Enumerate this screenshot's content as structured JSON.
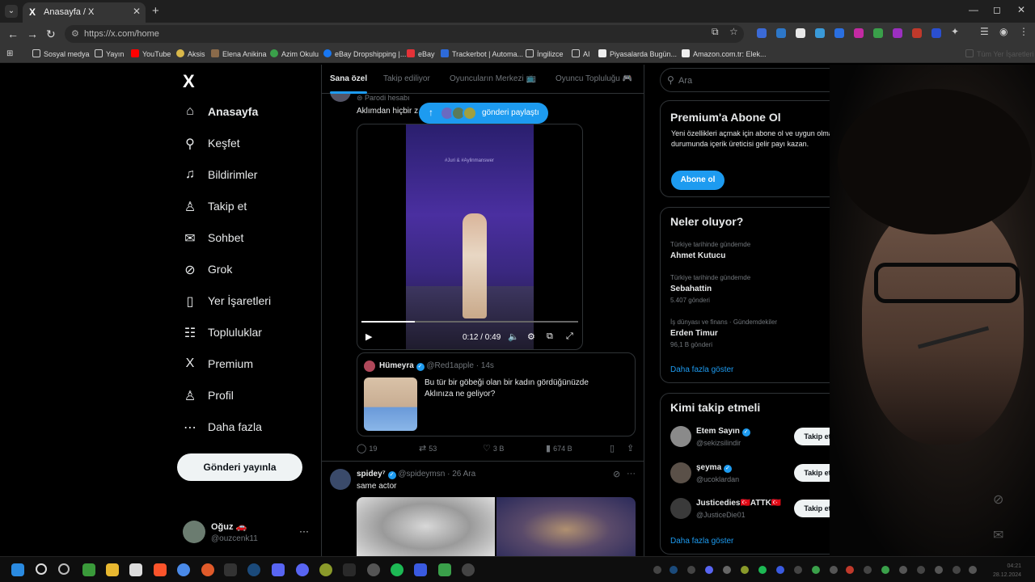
{
  "browser": {
    "tab_title": "Anasayfa / X",
    "tab_icon": "X",
    "url": "https://x.com/home",
    "bookmarks": [
      "Sosyal medya",
      "Yayın",
      "YouTube",
      "Aksis",
      "Elena Anikina",
      "Azim Okulu",
      "eBay Dropshipping |...",
      "eBay",
      "Trackerbot | Automa...",
      "İngilizce",
      "AI",
      "Piyasalarda Bugün...",
      "Amazon.com.tr: Elek..."
    ],
    "bookmarks_all": "Tüm Yer İşaretleri"
  },
  "sidebar": {
    "logo": "X",
    "items": [
      {
        "label": "Anasayfa",
        "icon": "home-icon",
        "glyph": "⌂"
      },
      {
        "label": "Keşfet",
        "icon": "search-icon",
        "glyph": "⚲"
      },
      {
        "label": "Bildirimler",
        "icon": "bell-icon",
        "glyph": "♫"
      },
      {
        "label": "Takip et",
        "icon": "add-user-icon",
        "glyph": "♙"
      },
      {
        "label": "Sohbet",
        "icon": "mail-icon",
        "glyph": "✉"
      },
      {
        "label": "Grok",
        "icon": "grok-icon",
        "glyph": "⊘"
      },
      {
        "label": "Yer İşaretleri",
        "icon": "bookmark-icon",
        "glyph": "▯"
      },
      {
        "label": "Topluluklar",
        "icon": "communities-icon",
        "glyph": "☷"
      },
      {
        "label": "Premium",
        "icon": "premium-icon",
        "glyph": "X"
      },
      {
        "label": "Profil",
        "icon": "profile-icon",
        "glyph": "♙"
      },
      {
        "label": "Daha fazla",
        "icon": "more-icon",
        "glyph": "⋯"
      }
    ],
    "post_button": "Gönderi yayınla",
    "profile": {
      "name": "Oğuz 🚗",
      "handle": "@ouzcenk11",
      "more": "···"
    }
  },
  "feed": {
    "tabs": [
      "Sana özel",
      "Takip ediliyor",
      "Oyuncuların Merkezi 📺",
      "Oyuncu Topluluğu 🎮"
    ],
    "new_posts_pill": "gönderi paylaştı",
    "post1": {
      "label": "Parodi hesabı",
      "text": "Aklımdan hiçbir z",
      "video": {
        "caption": "#Juri & #Aylinmanswer",
        "time": "0:12 / 0:49",
        "progress": 0.245
      },
      "quote": {
        "name": "Hümeyra",
        "handle": "@Red1apple",
        "time": "14s",
        "text": "Bu tür bir göbeği olan bir kadın gördüğünüzde Aklınıza ne geliyor?"
      },
      "stats": {
        "replies": "19",
        "reposts": "53",
        "likes": "3 B",
        "views": "674 B"
      }
    },
    "post2": {
      "name": "spidey⁷",
      "handle": "@spideymsn",
      "date": "26 Ara",
      "text": "same actor"
    }
  },
  "right": {
    "search_placeholder": "Ara",
    "premium": {
      "title": "Premium'a Abone Ol",
      "body": "Yeni özellikleri açmak için abone ol ve uygun olman durumunda içerik üreticisi gelir payı kazan.",
      "button": "Abone ol"
    },
    "trends": {
      "title": "Neler oluyor?",
      "items": [
        {
          "meta": "Türkiye tarihinde gündemde",
          "name": "Ahmet Kutucu",
          "count": ""
        },
        {
          "meta": "Türkiye tarihinde gündemde",
          "name": "Sebahattin",
          "count": "5.407 gönderi"
        },
        {
          "meta": "İş dünyası ve finans · Gündemdekiler",
          "name": "Erden Timur",
          "count": "96,1 B gönderi"
        }
      ],
      "show_more": "Daha fazla göster"
    },
    "who_to_follow": {
      "title": "Kimi takip etmeli",
      "items": [
        {
          "name": "Etem Sayın",
          "handle": "@sekizsilindir",
          "button": "Takip et"
        },
        {
          "name": "şeyma",
          "handle": "@ucoklardan",
          "button": "Takip et"
        },
        {
          "name": "Justicedies🇹🇷ATTK🇹🇷",
          "handle": "@JusticeDie01",
          "button": "Takip et"
        }
      ],
      "show_more": "Daha fazla göster"
    }
  },
  "taskbar": {
    "time": "04:21",
    "date": "28.12.2024"
  },
  "colors": {
    "accent": "#1d9bf0",
    "background": "#000000",
    "border": "#2f3336",
    "muted": "#71767b"
  }
}
